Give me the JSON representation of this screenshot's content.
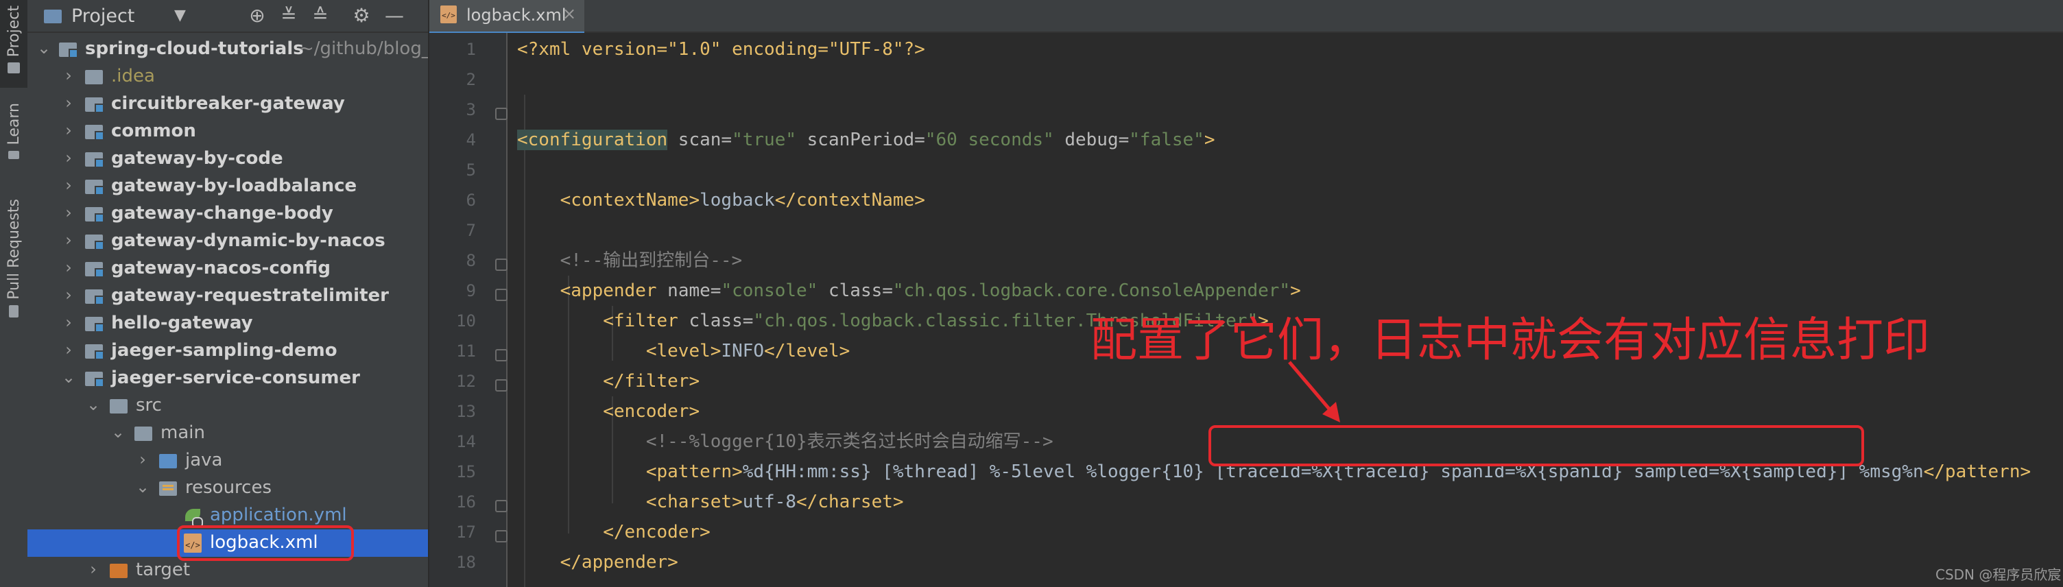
{
  "strip": {
    "project": "Project",
    "learn": "Learn",
    "pull_requests": "Pull Requests"
  },
  "project_panel": {
    "title": "Project",
    "icons": [
      "locate-icon",
      "expand-all-icon",
      "collapse-all-icon",
      "gear-icon",
      "minimize-icon"
    ],
    "tree": [
      {
        "label": "spring-cloud-tutorials",
        "path": "~/github/blog_c",
        "arrow": "down"
      },
      {
        "label": ".idea",
        "arrow": "right"
      },
      {
        "label": "circuitbreaker-gateway",
        "arrow": "right"
      },
      {
        "label": "common",
        "arrow": "right"
      },
      {
        "label": "gateway-by-code",
        "arrow": "right"
      },
      {
        "label": "gateway-by-loadbalance",
        "arrow": "right"
      },
      {
        "label": "gateway-change-body",
        "arrow": "right"
      },
      {
        "label": "gateway-dynamic-by-nacos",
        "arrow": "right"
      },
      {
        "label": "gateway-nacos-config",
        "arrow": "right"
      },
      {
        "label": "gateway-requestratelimiter",
        "arrow": "right"
      },
      {
        "label": "hello-gateway",
        "arrow": "right"
      },
      {
        "label": "jaeger-sampling-demo",
        "arrow": "right"
      },
      {
        "label": "jaeger-service-consumer",
        "arrow": "down"
      },
      {
        "label": "src",
        "arrow": "down"
      },
      {
        "label": "main",
        "arrow": "down"
      },
      {
        "label": "java",
        "arrow": "right"
      },
      {
        "label": "resources",
        "arrow": "down"
      },
      {
        "label": "application.yml"
      },
      {
        "label": "logback.xml"
      },
      {
        "label": "target",
        "arrow": "right"
      }
    ]
  },
  "editor": {
    "tab": {
      "name": "logback.xml",
      "close": "×"
    },
    "line_numbers": [
      "1",
      "2",
      "3",
      "4",
      "5",
      "6",
      "7",
      "8",
      "9",
      "10",
      "11",
      "12",
      "13",
      "14",
      "15",
      "16",
      "17",
      "18"
    ],
    "code": {
      "l1": {
        "decl": "<?xml version=\"1.0\" encoding=\"UTF-8\"?>"
      },
      "l3": {
        "tag": "<configuration",
        "a1": " scan=",
        "v1": "\"true\"",
        "a2": " scanPeriod=",
        "v2": "\"60 seconds\"",
        "a3": " debug=",
        "v3": "\"false\"",
        "end": ">"
      },
      "l5": {
        "open": "<contextName>",
        "text": "logback",
        "close": "</contextName>"
      },
      "l7": {
        "comment": "<!--输出到控制台-->"
      },
      "l8": {
        "tag": "<appender",
        "a1": " name=",
        "v1": "\"console\"",
        "a2": " class=",
        "v2": "\"ch.qos.logback.core.ConsoleAppender\"",
        "end": ">"
      },
      "l9": {
        "tag": "<filter",
        "a1": " class=",
        "v1": "\"ch.qos.logback.classic.filter.ThresholdFilter\"",
        "end": ">"
      },
      "l10": {
        "open": "<level>",
        "text": "INFO",
        "close": "</level>"
      },
      "l11": {
        "close": "</filter>"
      },
      "l12": {
        "open": "<encoder>"
      },
      "l13": {
        "comment": "<!--%logger{10}表示类名过长时会自动缩写-->"
      },
      "l14": {
        "open": "<pattern>",
        "text1": "%d{HH:mm:ss} [%thread] %-5level %logger{10} ",
        "text2": "[traceId=%X{traceId} spanId=%X{spanId} sampled=%X{sampled}]",
        "text3": " %msg%n",
        "close": "</pattern>"
      },
      "l15": {
        "open": "<charset>",
        "text": "utf-8",
        "close": "</charset>"
      },
      "l16": {
        "close": "</encoder>"
      },
      "l17": {
        "close": "</appender>"
      }
    }
  },
  "annotation": {
    "text": "配置了它们，日志中就会有对应信息打印"
  },
  "watermark": "CSDN @程序员欣宸",
  "colors": {
    "annotation_red": "#e5282d",
    "selection_blue": "#2f65ca",
    "tag_yellow": "#e8bf6a",
    "string_green": "#6a8759",
    "comment_gray": "#808080"
  }
}
